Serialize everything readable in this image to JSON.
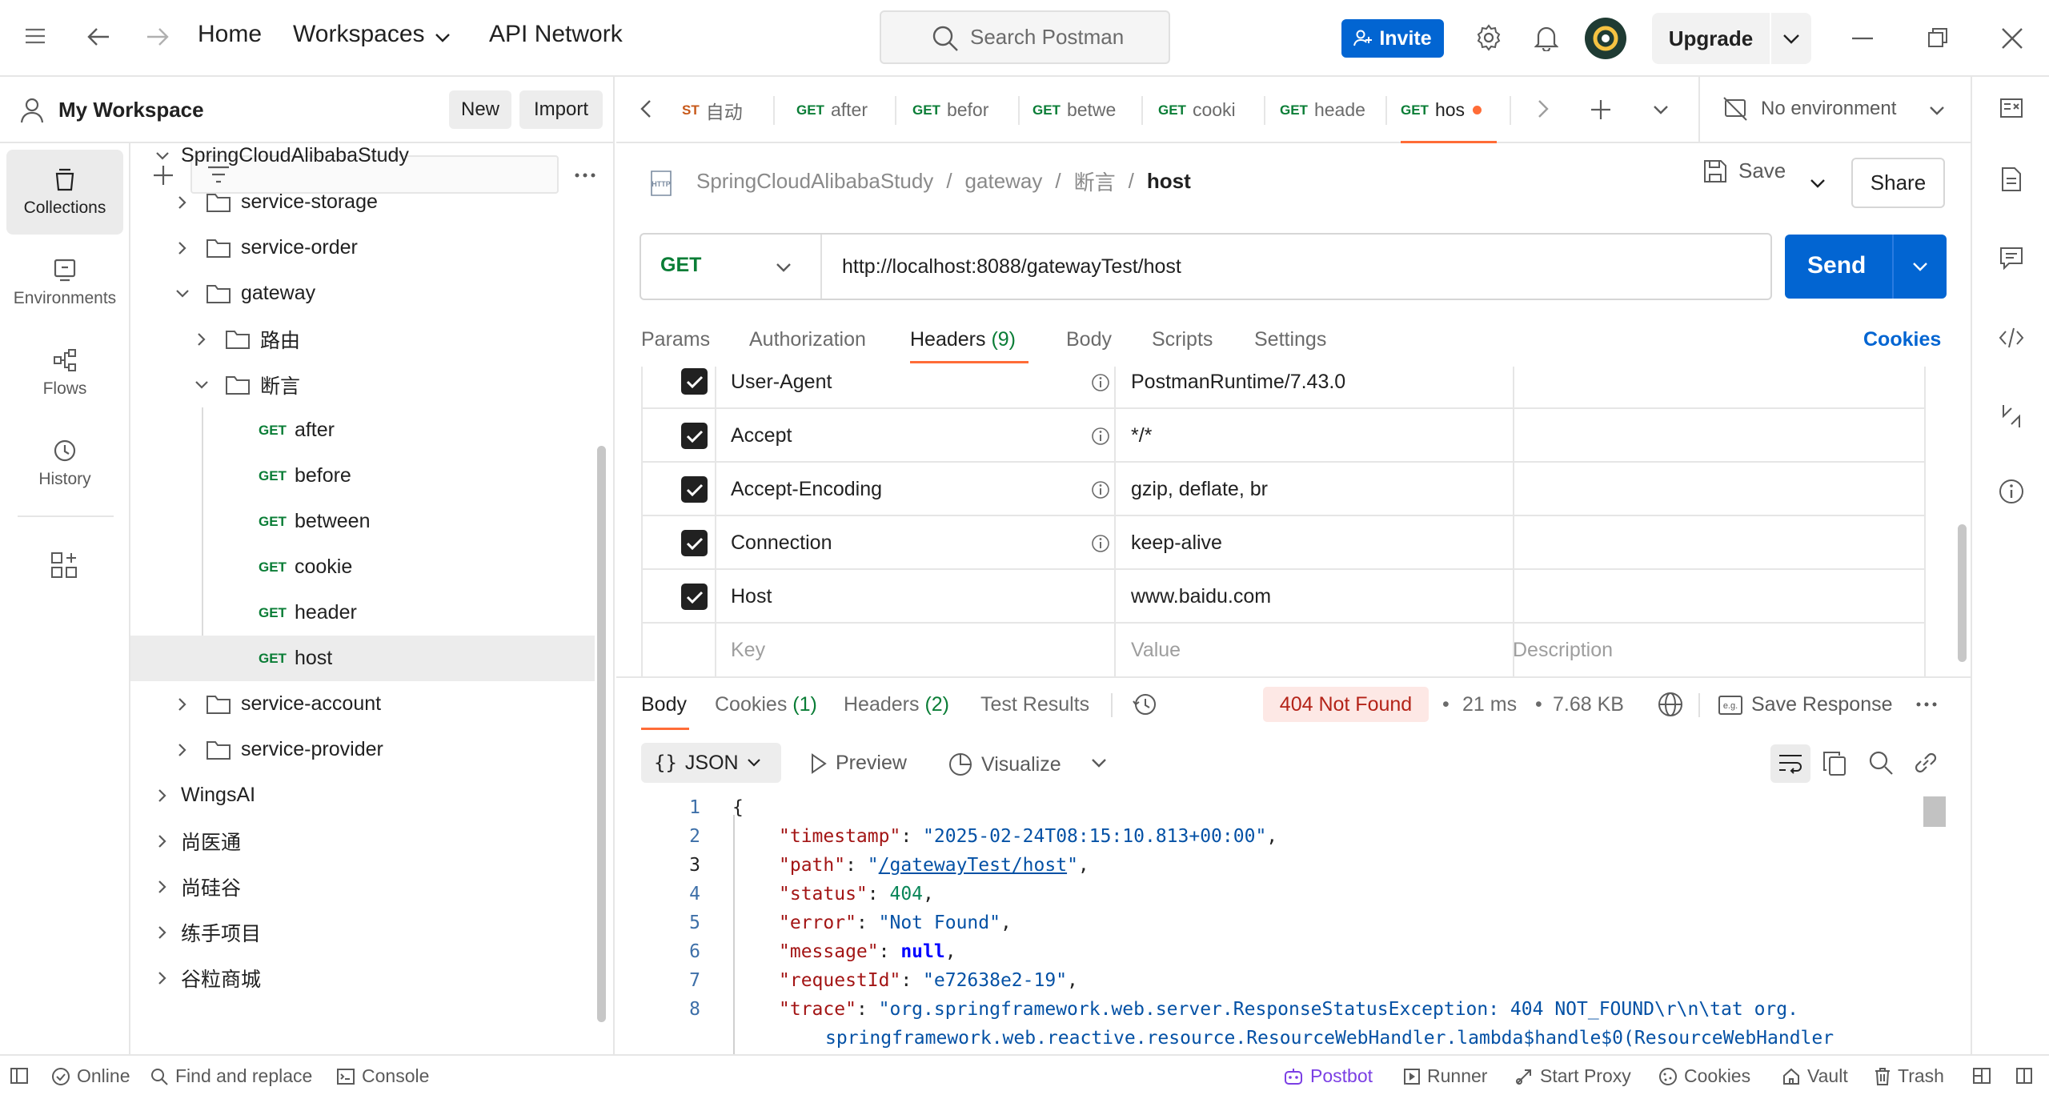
{
  "topbar": {
    "home": "Home",
    "workspaces": "Workspaces",
    "api_network": "API Network",
    "search_placeholder": "Search Postman",
    "invite": "Invite",
    "upgrade": "Upgrade"
  },
  "workspace": {
    "title": "My Workspace",
    "new_label": "New",
    "import_label": "Import"
  },
  "rail": {
    "collections": "Collections",
    "environments": "Environments",
    "flows": "Flows",
    "history": "History"
  },
  "tree": {
    "root": "SpringCloudAlibabaStudy",
    "service_storage": "service-storage",
    "service_order": "service-order",
    "gateway": "gateway",
    "routes": "路由",
    "predicates": "断言",
    "requests": [
      {
        "method": "GET",
        "name": "after"
      },
      {
        "method": "GET",
        "name": "before"
      },
      {
        "method": "GET",
        "name": "between"
      },
      {
        "method": "GET",
        "name": "cookie"
      },
      {
        "method": "GET",
        "name": "header"
      },
      {
        "method": "GET",
        "name": "host"
      }
    ],
    "service_account": "service-account",
    "service_provider": "service-provider",
    "collections": [
      "WingsAI",
      "尚医通",
      "尚硅谷",
      "练手项目",
      "谷粒商城"
    ]
  },
  "tabs": [
    {
      "method": "ST",
      "name": "自动"
    },
    {
      "method": "GET",
      "name": "after"
    },
    {
      "method": "GET",
      "name": "befor"
    },
    {
      "method": "GET",
      "name": "betwe"
    },
    {
      "method": "GET",
      "name": "cooki"
    },
    {
      "method": "GET",
      "name": "heade"
    },
    {
      "method": "GET",
      "name": "hos"
    }
  ],
  "environment": "No environment",
  "breadcrumb": {
    "collection": "SpringCloudAlibabaStudy",
    "folder1": "gateway",
    "folder2": "断言",
    "current": "host",
    "sep": "/"
  },
  "request": {
    "save": "Save",
    "share": "Share",
    "method": "GET",
    "url": "http://localhost:8088/gatewayTest/host",
    "send": "Send",
    "tabs": {
      "params": "Params",
      "authorization": "Authorization",
      "headers": "Headers",
      "headers_count": "(9)",
      "body": "Body",
      "scripts": "Scripts",
      "settings": "Settings",
      "cookies": "Cookies"
    },
    "headers": [
      {
        "key": "User-Agent",
        "value": "PostmanRuntime/7.43.0"
      },
      {
        "key": "Accept",
        "value": "*/*"
      },
      {
        "key": "Accept-Encoding",
        "value": "gzip, deflate, br"
      },
      {
        "key": "Connection",
        "value": "keep-alive"
      },
      {
        "key": "Host",
        "value": "www.baidu.com"
      }
    ],
    "placeholders": {
      "key": "Key",
      "value": "Value",
      "description": "Description"
    }
  },
  "response": {
    "tabs": {
      "body": "Body",
      "cookies": "Cookies",
      "cookies_count": "(1)",
      "headers": "Headers",
      "headers_count": "(2)",
      "test_results": "Test Results"
    },
    "status": "404 Not Found",
    "time": "21 ms",
    "size": "7.68 KB",
    "save_response": "Save Response",
    "format": "JSON",
    "preview": "Preview",
    "visualize": "Visualize",
    "line_numbers": [
      "1",
      "2",
      "3",
      "4",
      "5",
      "6",
      "7",
      "8"
    ],
    "json": {
      "open_brace": "{",
      "timestamp_key": "\"timestamp\"",
      "timestamp_val": "\"2025-02-24T08:15:10.813+00:00\"",
      "path_key": "\"path\"",
      "path_q": "\"",
      "path_val": "/gatewayTest/host",
      "status_key": "\"status\"",
      "status_val": "404",
      "error_key": "\"error\"",
      "error_val": "\"Not Found\"",
      "message_key": "\"message\"",
      "message_val": "null",
      "requestId_key": "\"requestId\"",
      "requestId_val": "\"e72638e2-19\"",
      "trace_key": "\"trace\"",
      "trace_val": "\"org.springframework.web.server.ResponseStatusException: 404 NOT_FOUND\\r\\n\\tat org.",
      "trace_cont": "springframework.web.reactive.resource.ResourceWebHandler.lambda$handle$0(ResourceWebHandler"
    }
  },
  "statusbar": {
    "online": "Online",
    "find_replace": "Find and replace",
    "console": "Console",
    "postbot": "Postbot",
    "runner": "Runner",
    "start_proxy": "Start Proxy",
    "cookies": "Cookies",
    "vault": "Vault",
    "trash": "Trash"
  },
  "colors": {
    "brand_orange": "#ff6c37",
    "primary_blue": "#0265d2",
    "get_green": "#0a7d36",
    "error_red": "#b42318"
  }
}
